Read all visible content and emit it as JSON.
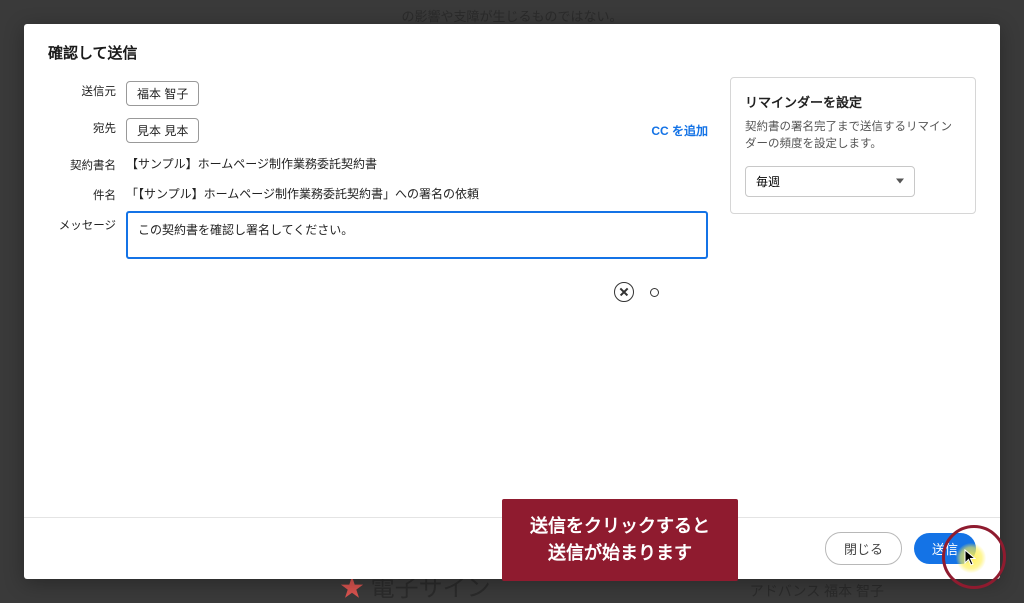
{
  "backdrop": {
    "top_text": "の影響や支障が生じるものではない。",
    "bottom_left_prefix": "電子サイン",
    "bottom_right": "アドバンス 福本 智子"
  },
  "modal": {
    "title": "確認して送信",
    "labels": {
      "sender": "送信元",
      "recipient": "宛先",
      "contract_name": "契約書名",
      "subject": "件名",
      "message": "メッセージ"
    },
    "values": {
      "sender": "福本 智子",
      "recipient": "見本 見本",
      "cc_add": "CC を追加",
      "contract_name": "【サンプル】ホームページ制作業務委託契約書",
      "subject": "「【サンプル】ホームページ制作業務委託契約書」への署名の依頼",
      "message": "この契約書を確認し署名してください。"
    },
    "reminder": {
      "title": "リマインダーを設定",
      "description": "契約書の署名完了まで送信するリマインダーの頻度を設定します。",
      "selected": "毎週"
    },
    "footer": {
      "close": "閉じる",
      "send": "送信"
    }
  },
  "tooltip": {
    "line1": "送信をクリックすると",
    "line2": "送信が始まります"
  }
}
